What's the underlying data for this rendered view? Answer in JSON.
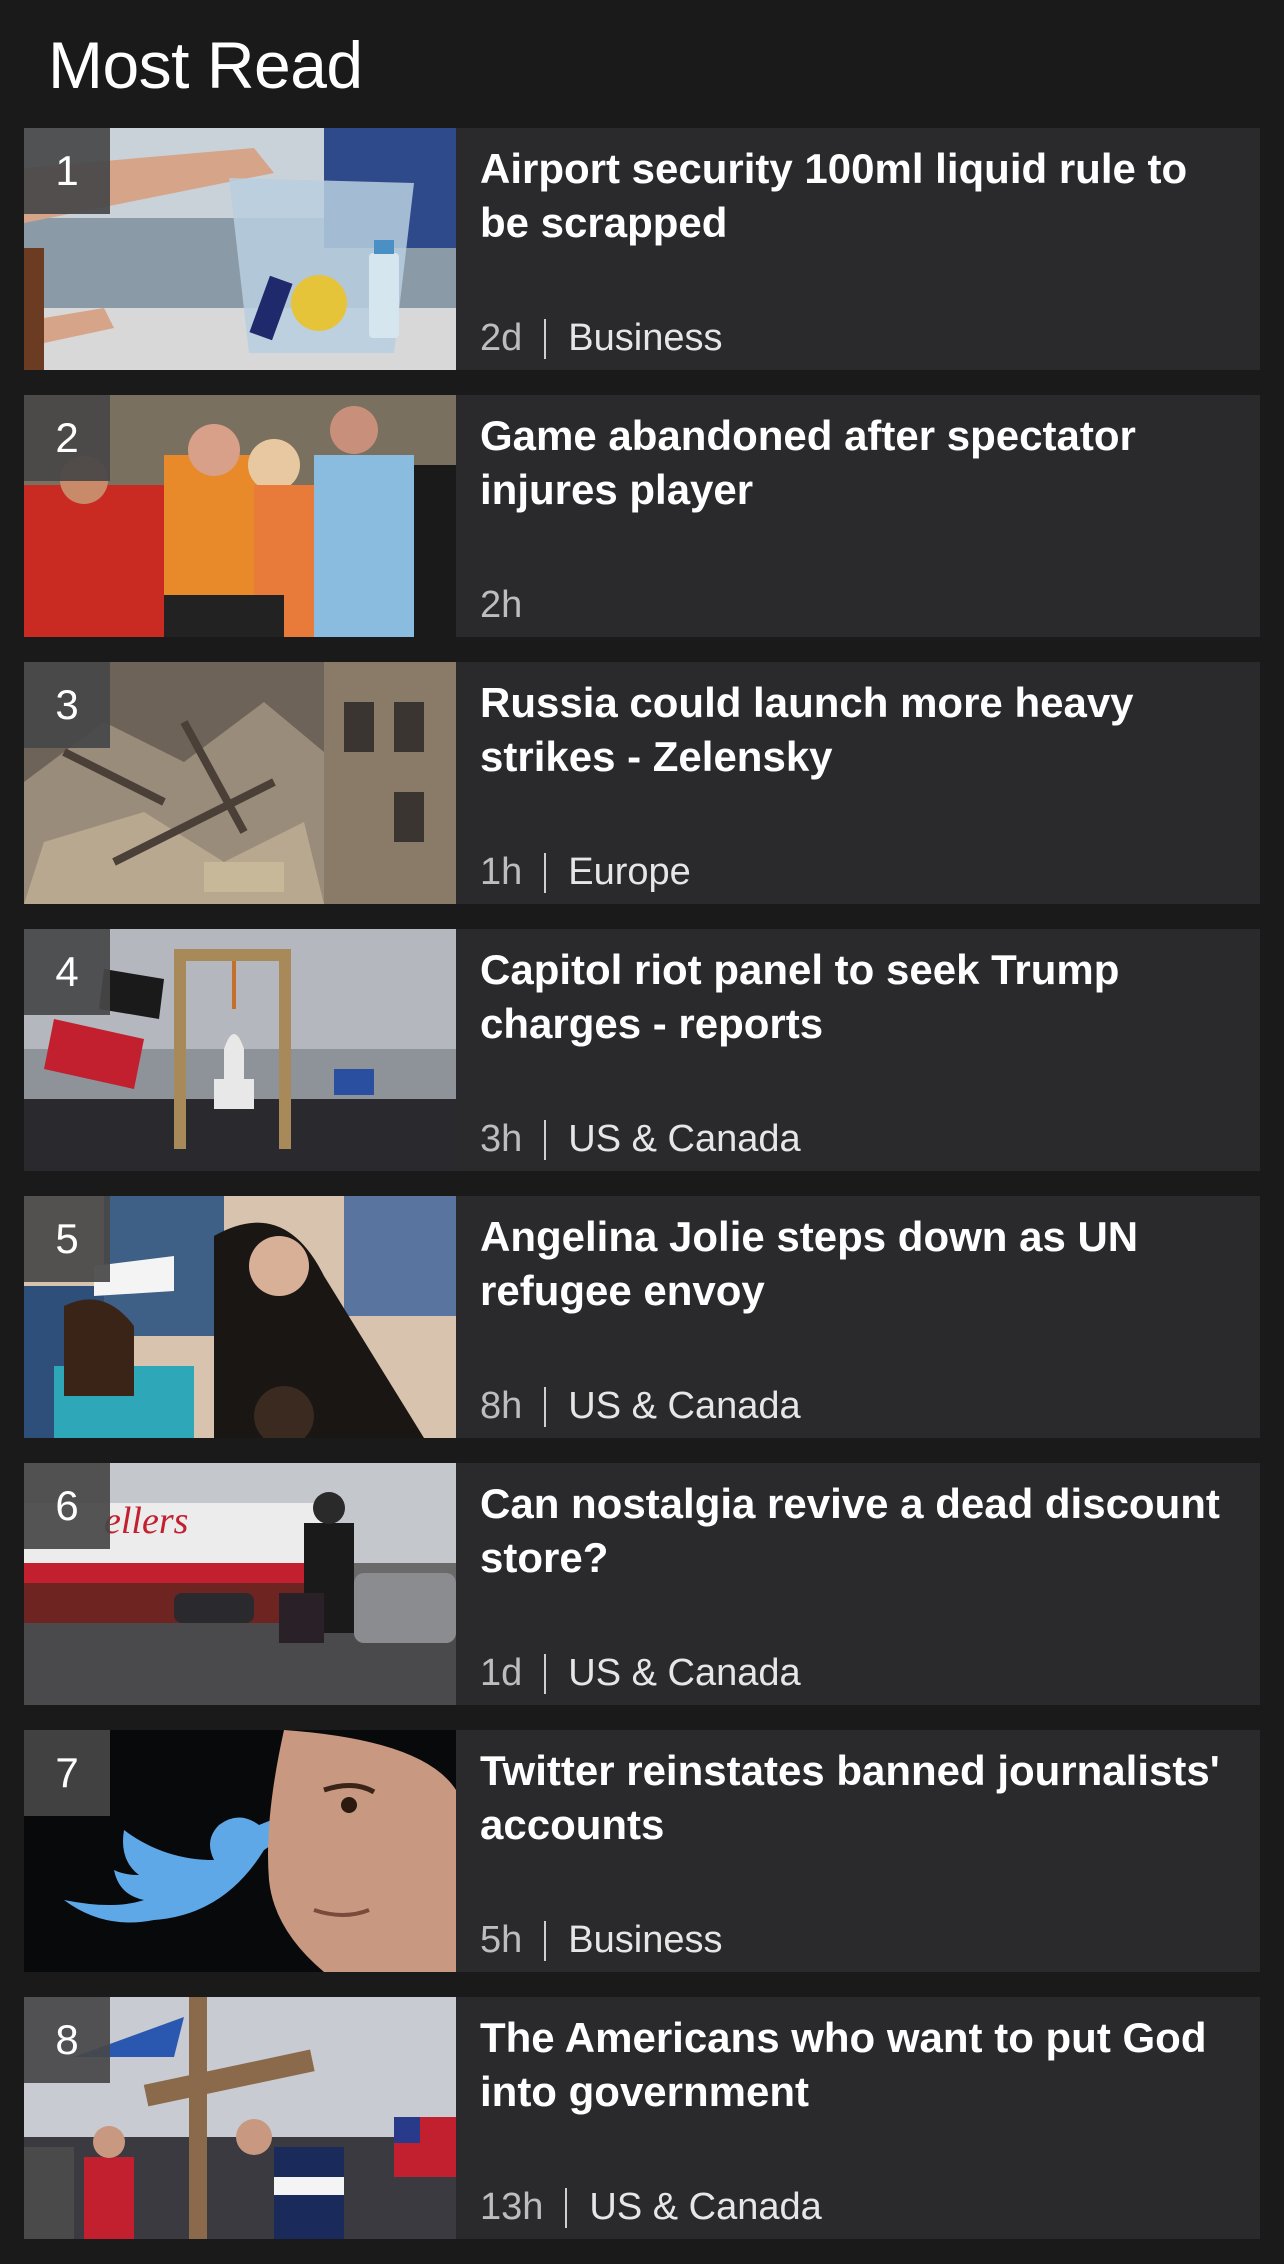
{
  "header": {
    "title": "Most Read"
  },
  "articles": [
    {
      "rank": "1",
      "headline": "Airport security 100ml liquid rule to be scrapped",
      "age": "2d",
      "category": "Business",
      "image": "liquids-bag-photo"
    },
    {
      "rank": "2",
      "headline": "Game abandoned after spectator injures player",
      "age": "2h",
      "category": "",
      "image": "football-players-photo"
    },
    {
      "rank": "3",
      "headline": "Russia could launch more heavy strikes - Zelensky",
      "age": "1h",
      "category": "Europe",
      "image": "rubble-building-photo"
    },
    {
      "rank": "4",
      "headline": "Capitol riot panel to seek Trump charges - reports",
      "age": "3h",
      "category": "US & Canada",
      "image": "capitol-gallows-photo"
    },
    {
      "rank": "5",
      "headline": "Angelina Jolie steps down as UN refugee envoy",
      "age": "8h",
      "category": "US & Canada",
      "image": "jolie-children-photo"
    },
    {
      "rank": "6",
      "headline": "Can nostalgia revive a dead discount store?",
      "age": "1d",
      "category": "US & Canada",
      "image": "zellers-store-photo"
    },
    {
      "rank": "7",
      "headline": "Twitter reinstates banned journalists' accounts",
      "age": "5h",
      "category": "Business",
      "image": "twitter-musk-photo"
    },
    {
      "rank": "8",
      "headline": "The Americans who want to put God into government",
      "age": "13h",
      "category": "US & Canada",
      "image": "cross-crowd-photo"
    }
  ]
}
